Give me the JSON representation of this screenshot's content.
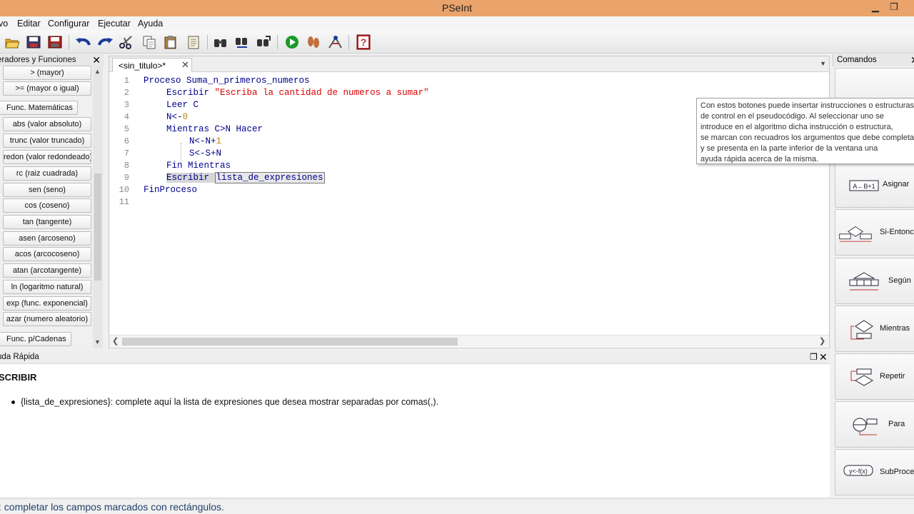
{
  "window": {
    "title": "PSeInt"
  },
  "menu": [
    "vo",
    "Editar",
    "Configurar",
    "Ejecutar",
    "Ayuda"
  ],
  "toolbar": {
    "icons": [
      "open-icon",
      "save-icon",
      "save-as-icon",
      "undo-icon",
      "redo-icon",
      "cut-icon",
      "copy-icon",
      "paste-icon",
      "edit-icon",
      "search-icon",
      "replace-icon",
      "next-icon",
      "run-icon",
      "step-icon",
      "debug-icon",
      "help-icon"
    ]
  },
  "left_panel": {
    "title": "eradores y Funciones",
    "buttons": [
      "> (mayor)",
      ">= (mayor o igual)",
      "abs (valor absoluto)",
      "trunc (valor truncado)",
      "redon (valor redondeado)",
      "rc (raiz cuadrada)",
      "sen (seno)",
      "cos (coseno)",
      "tan (tangente)",
      "asen (arcoseno)",
      "acos (arcocoseno)",
      "atan (arcotangente)",
      "ln (logaritmo natural)",
      "exp (func. exponencial)",
      "azar (numero aleatorio)"
    ],
    "categories": [
      "Func. Matemáticas",
      "Func. p/Cadenas"
    ]
  },
  "editor": {
    "tab_label": "<sin_titulo>*",
    "line_numbers": [
      "1",
      "2",
      "3",
      "4",
      "5",
      "6",
      "7",
      "8",
      "9",
      "10",
      "11"
    ],
    "lines": {
      "l1": "Proceso Suma_n_primeros_numeros",
      "l2_kw": "Escribir",
      "l2_str": "\"Escriba la cantidad de numeros a sumar\"",
      "l3": "Leer C",
      "l4_a": "N<-",
      "l4_b": "0",
      "l5": "Mientras C>N Hacer",
      "l6_a": "N<-N+",
      "l6_b": "1",
      "l7": "S<-S+N",
      "l8": "Fin Mientras",
      "l9_kw": "Escribir",
      "l9_field": "lista_de_expresiones",
      "l10": "FinProceso"
    }
  },
  "tooltip": {
    "lines": [
      "Con estos botones puede insertar instrucciones o estructuras",
      "de control en el pseudocódigo. Al seleccionar uno se",
      "introduce en el algoritmo dicha instrucción o estructura,",
      "se marcan con recuadros los argumentos que debe completar",
      "y se presenta en la parte inferior de la ventana una",
      "ayuda rápida acerca de la misma."
    ]
  },
  "right_panel": {
    "title": "Comandos",
    "commands": [
      "Asignar",
      "Si-Entonces",
      "Según",
      "Mientras",
      "Repetir",
      "Para",
      "SubProceso"
    ]
  },
  "help_panel": {
    "title": "uda Rápida",
    "heading": "SCRIBIR",
    "item": "{lista_de_expresiones}: complete aquí la lista de expresiones que desea mostrar separadas por comas(,)."
  },
  "statusbar": {
    "text": ": completar los campos marcados con rectángulos."
  },
  "colors": {
    "titlebar": "#e9a36b",
    "keyword": "#00008b",
    "string": "#dd0000",
    "number": "#b8860b"
  }
}
